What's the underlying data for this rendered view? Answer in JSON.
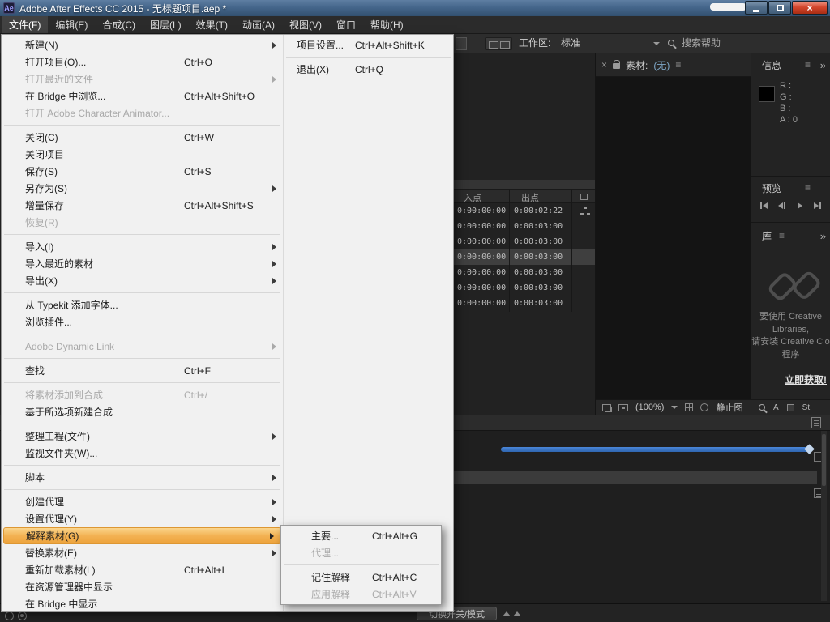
{
  "titlebar": {
    "app_icon": "Ae",
    "title": "Adobe After Effects CC 2015 - 无标题项目.aep *",
    "close_glyph": "×"
  },
  "menubar": {
    "items": [
      {
        "label": "文件(F)",
        "active": true
      },
      {
        "label": "编辑(E)"
      },
      {
        "label": "合成(C)"
      },
      {
        "label": "图层(L)"
      },
      {
        "label": "效果(T)"
      },
      {
        "label": "动画(A)"
      },
      {
        "label": "视图(V)"
      },
      {
        "label": "窗口"
      },
      {
        "label": "帮助(H)"
      }
    ]
  },
  "toolbar": {
    "workspace_label": "工作区:",
    "workspace_value": "标准",
    "search_label": "搜索帮助"
  },
  "file_menu": {
    "col1": [
      {
        "label": "新建(N)",
        "submenu": true
      },
      {
        "label": "打开项目(O)...",
        "shortcut": "Ctrl+O"
      },
      {
        "label": "打开最近的文件",
        "submenu": true,
        "disabled": true
      },
      {
        "label": "在 Bridge 中浏览...",
        "shortcut": "Ctrl+Alt+Shift+O"
      },
      {
        "label": "打开 Adobe Character Animator...",
        "disabled": true
      },
      {
        "sep": true
      },
      {
        "label": "关闭(C)",
        "shortcut": "Ctrl+W"
      },
      {
        "label": "关闭项目"
      },
      {
        "label": "保存(S)",
        "shortcut": "Ctrl+S"
      },
      {
        "label": "另存为(S)",
        "submenu": true
      },
      {
        "label": "增量保存",
        "shortcut": "Ctrl+Alt+Shift+S"
      },
      {
        "label": "恢复(R)",
        "disabled": true
      },
      {
        "sep": true
      },
      {
        "label": "导入(I)",
        "submenu": true
      },
      {
        "label": "导入最近的素材",
        "submenu": true
      },
      {
        "label": "导出(X)",
        "submenu": true
      },
      {
        "sep": true
      },
      {
        "label": "从 Typekit 添加字体..."
      },
      {
        "label": "浏览插件..."
      },
      {
        "sep": true
      },
      {
        "label": "Adobe Dynamic Link",
        "submenu": true,
        "disabled": true
      },
      {
        "sep": true
      },
      {
        "label": "查找",
        "shortcut": "Ctrl+F"
      },
      {
        "sep": true
      },
      {
        "label": "将素材添加到合成",
        "shortcut": "Ctrl+/",
        "disabled": true
      },
      {
        "label": "基于所选项新建合成"
      },
      {
        "sep": true
      },
      {
        "label": "整理工程(文件)",
        "submenu": true
      },
      {
        "label": "监视文件夹(W)..."
      },
      {
        "sep": true
      },
      {
        "label": "脚本",
        "submenu": true
      },
      {
        "sep": true
      },
      {
        "label": "创建代理",
        "submenu": true
      },
      {
        "label": "设置代理(Y)",
        "submenu": true
      },
      {
        "label": "解释素材(G)",
        "submenu": true,
        "highlighted": true
      },
      {
        "label": "替换素材(E)",
        "submenu": true
      },
      {
        "label": "重新加载素材(L)",
        "shortcut": "Ctrl+Alt+L"
      },
      {
        "label": "在资源管理器中显示"
      },
      {
        "label": "在 Bridge 中显示"
      }
    ],
    "col2": [
      {
        "label": "项目设置...",
        "shortcut": "Ctrl+Alt+Shift+K"
      },
      {
        "sep": true
      },
      {
        "label": "退出(X)",
        "shortcut": "Ctrl+Q"
      }
    ]
  },
  "interpret_submenu": {
    "items": [
      {
        "label": "主要...",
        "shortcut": "Ctrl+Alt+G"
      },
      {
        "label": "代理...",
        "disabled": true
      },
      {
        "sep": true
      },
      {
        "label": "记住解释",
        "shortcut": "Ctrl+Alt+C"
      },
      {
        "label": "应用解释",
        "shortcut": "Ctrl+Alt+V",
        "disabled": true
      }
    ]
  },
  "footage_table": {
    "columns": [
      "入点",
      "出点"
    ],
    "rows": [
      {
        "in_point": "0:00:00:00",
        "out_point": "0:00:02:22",
        "icon": true
      },
      {
        "in_point": "0:00:00:00",
        "out_point": "0:00:03:00"
      },
      {
        "in_point": "0:00:00:00",
        "out_point": "0:00:03:00"
      },
      {
        "in_point": "0:00:00:00",
        "out_point": "0:00:03:00",
        "selected": true
      },
      {
        "in_point": "0:00:00:00",
        "out_point": "0:00:03:00"
      },
      {
        "in_point": "0:00:00:00",
        "out_point": "0:00:03:00"
      },
      {
        "in_point": "0:00:00:00",
        "out_point": "0:00:03:00"
      }
    ]
  },
  "viewer": {
    "close_glyph": "×",
    "tab_label": "素材:",
    "tab_state": "(无)",
    "menu_glyph": "≡",
    "zoom_value": "(100%)",
    "still_label": "静止图"
  },
  "info_panel": {
    "title": "信息",
    "menu_glyph": "≡",
    "overflow_glyph": "»",
    "r": "R :",
    "g": "G :",
    "b": "B :",
    "a": "A : 0"
  },
  "preview_panel": {
    "title": "预览",
    "menu_glyph": "≡"
  },
  "library_panel": {
    "title": "库",
    "menu_glyph": "≡",
    "overflow_glyph": "»",
    "lines": [
      "要使用 Creative",
      "Libraries,",
      "请安装 Creative Clo",
      "程序"
    ],
    "link": "立即获取!",
    "char_style_label": "A",
    "stock_label": "St"
  },
  "timeline": {
    "toggle_button": "切换开关/模式"
  }
}
